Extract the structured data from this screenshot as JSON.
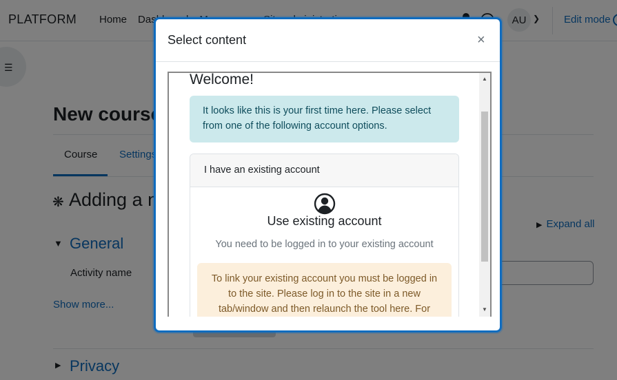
{
  "navbar": {
    "brand": "PLATFORM",
    "links": [
      "Home",
      "Dashboard",
      "My courses",
      "Site administration"
    ],
    "avatar_initials": "AU",
    "edit_mode_label": "Edit mode"
  },
  "page": {
    "title": "New course",
    "tabs": [
      "Course",
      "Settings"
    ],
    "heading": "Adding a new",
    "expand_all": "Expand all",
    "section_general": "General",
    "activity_name_label": "Activity name",
    "show_more": "Show more...",
    "section_privacy": "Privacy"
  },
  "modal": {
    "title": "Select content",
    "close_glyph": "×",
    "welcome": "Welcome!",
    "info_text": "It looks like this is your first time here. Please select from one of the following account options.",
    "card_header": "I have an existing account",
    "card_title": "Use existing account",
    "card_subtitle": "You need to be logged in to your existing account",
    "warning_text": "To link your existing account you must be logged in to the site. Please log in to the site in a new tab/window and then relaunch the tool here. For"
  },
  "colors": {
    "primary": "#0f6cbf",
    "info_bg": "#cce9ec",
    "warning_bg": "#fcefdc",
    "backdrop": "rgba(0,0,0,0.5)"
  },
  "icons": [
    "notification-bell-icon",
    "chat-icon",
    "chevron-down-icon",
    "list-icon",
    "puzzle-icon",
    "caret-right-icon",
    "caret-down-icon",
    "close-icon",
    "user-circle-icon",
    "scroll-up-icon",
    "scroll-down-icon"
  ]
}
